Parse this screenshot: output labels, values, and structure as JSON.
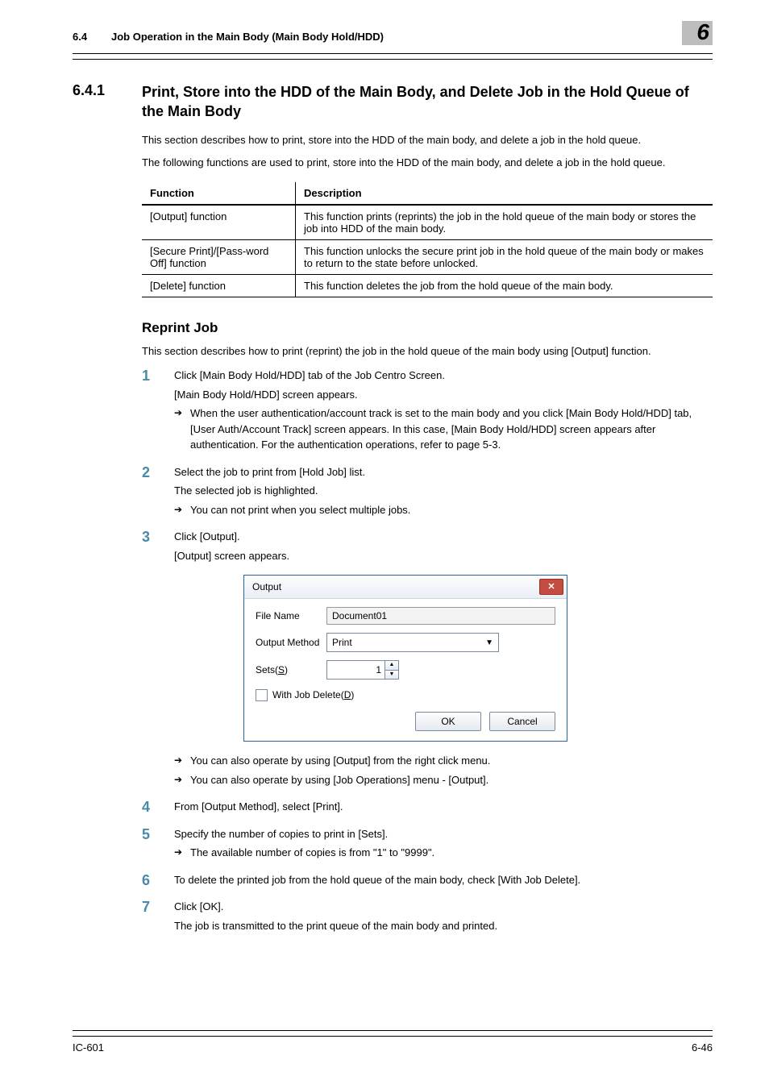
{
  "header": {
    "section_num": "6.4",
    "section_title": "Job Operation in the Main Body (Main Body Hold/HDD)",
    "chapter_num": "6"
  },
  "section": {
    "num": "6.4.1",
    "title": "Print, Store into the HDD of the Main Body, and Delete Job in the Hold Queue of the Main Body"
  },
  "intro_p1": "This section describes how to print, store into the HDD of the main body, and delete a job in the hold queue.",
  "intro_p2": "The following functions are used to print, store into the HDD of the main body, and delete a job in the hold queue.",
  "table": {
    "head_function": "Function",
    "head_description": "Description",
    "rows": [
      {
        "function": "[Output] function",
        "description": "This function prints (reprints) the job in the hold queue of the main body or stores the job into HDD of the main body."
      },
      {
        "function": "[Secure Print]/[Pass-word Off] function",
        "description": "This function unlocks the secure print job in the hold queue of the main body or makes to return to the state before unlocked."
      },
      {
        "function": "[Delete] function",
        "description": "This function deletes the job from the hold queue of the main body."
      }
    ]
  },
  "reprint": {
    "heading": "Reprint Job",
    "intro": "This section describes how to print (reprint) the job in the hold queue of the main body using [Output] function."
  },
  "steps": {
    "s1": {
      "main": "Click [Main Body Hold/HDD] tab of the Job Centro Screen.",
      "cap": "[Main Body Hold/HDD] screen appears.",
      "arrow": "When the user authentication/account track is set to the main body and you click [Main Body Hold/HDD] tab, [User Auth/Account Track] screen appears. In this case, [Main Body Hold/HDD] screen appears after authentication. For the authentication operations, refer to page 5-3."
    },
    "s2": {
      "main": "Select the job to print from [Hold Job] list.",
      "cap": "The selected job is highlighted.",
      "arrow": "You can not print when you select multiple jobs."
    },
    "s3": {
      "main": "Click [Output].",
      "cap": "[Output] screen appears.",
      "arrow1": "You can also operate by using [Output] from the right click menu.",
      "arrow2": "You can also operate by using [Job Operations] menu - [Output]."
    },
    "s4": {
      "main": "From [Output Method], select [Print]."
    },
    "s5": {
      "main": "Specify the number of copies to print in [Sets].",
      "arrow": "The available number of copies is from \"1\" to \"9999\"."
    },
    "s6": {
      "main": "To delete the printed job from the hold queue of the main body, check [With Job Delete]."
    },
    "s7": {
      "main": "Click [OK].",
      "cap": "The job is transmitted to the print queue of the main body and printed."
    }
  },
  "dialog": {
    "title": "Output",
    "close_glyph": "✕",
    "file_name_label": "File Name",
    "file_name_value": "Document01",
    "output_method_label": "Output Method",
    "output_method_value": "Print",
    "sets_label_pre": "Sets(",
    "sets_label_key": "S",
    "sets_label_post": ")",
    "sets_value": "1",
    "with_job_delete_pre": "With Job Delete(",
    "with_job_delete_key": "D",
    "with_job_delete_post": ")",
    "ok": "OK",
    "cancel": "Cancel"
  },
  "footer": {
    "left": "IC-601",
    "right": "6-46"
  }
}
